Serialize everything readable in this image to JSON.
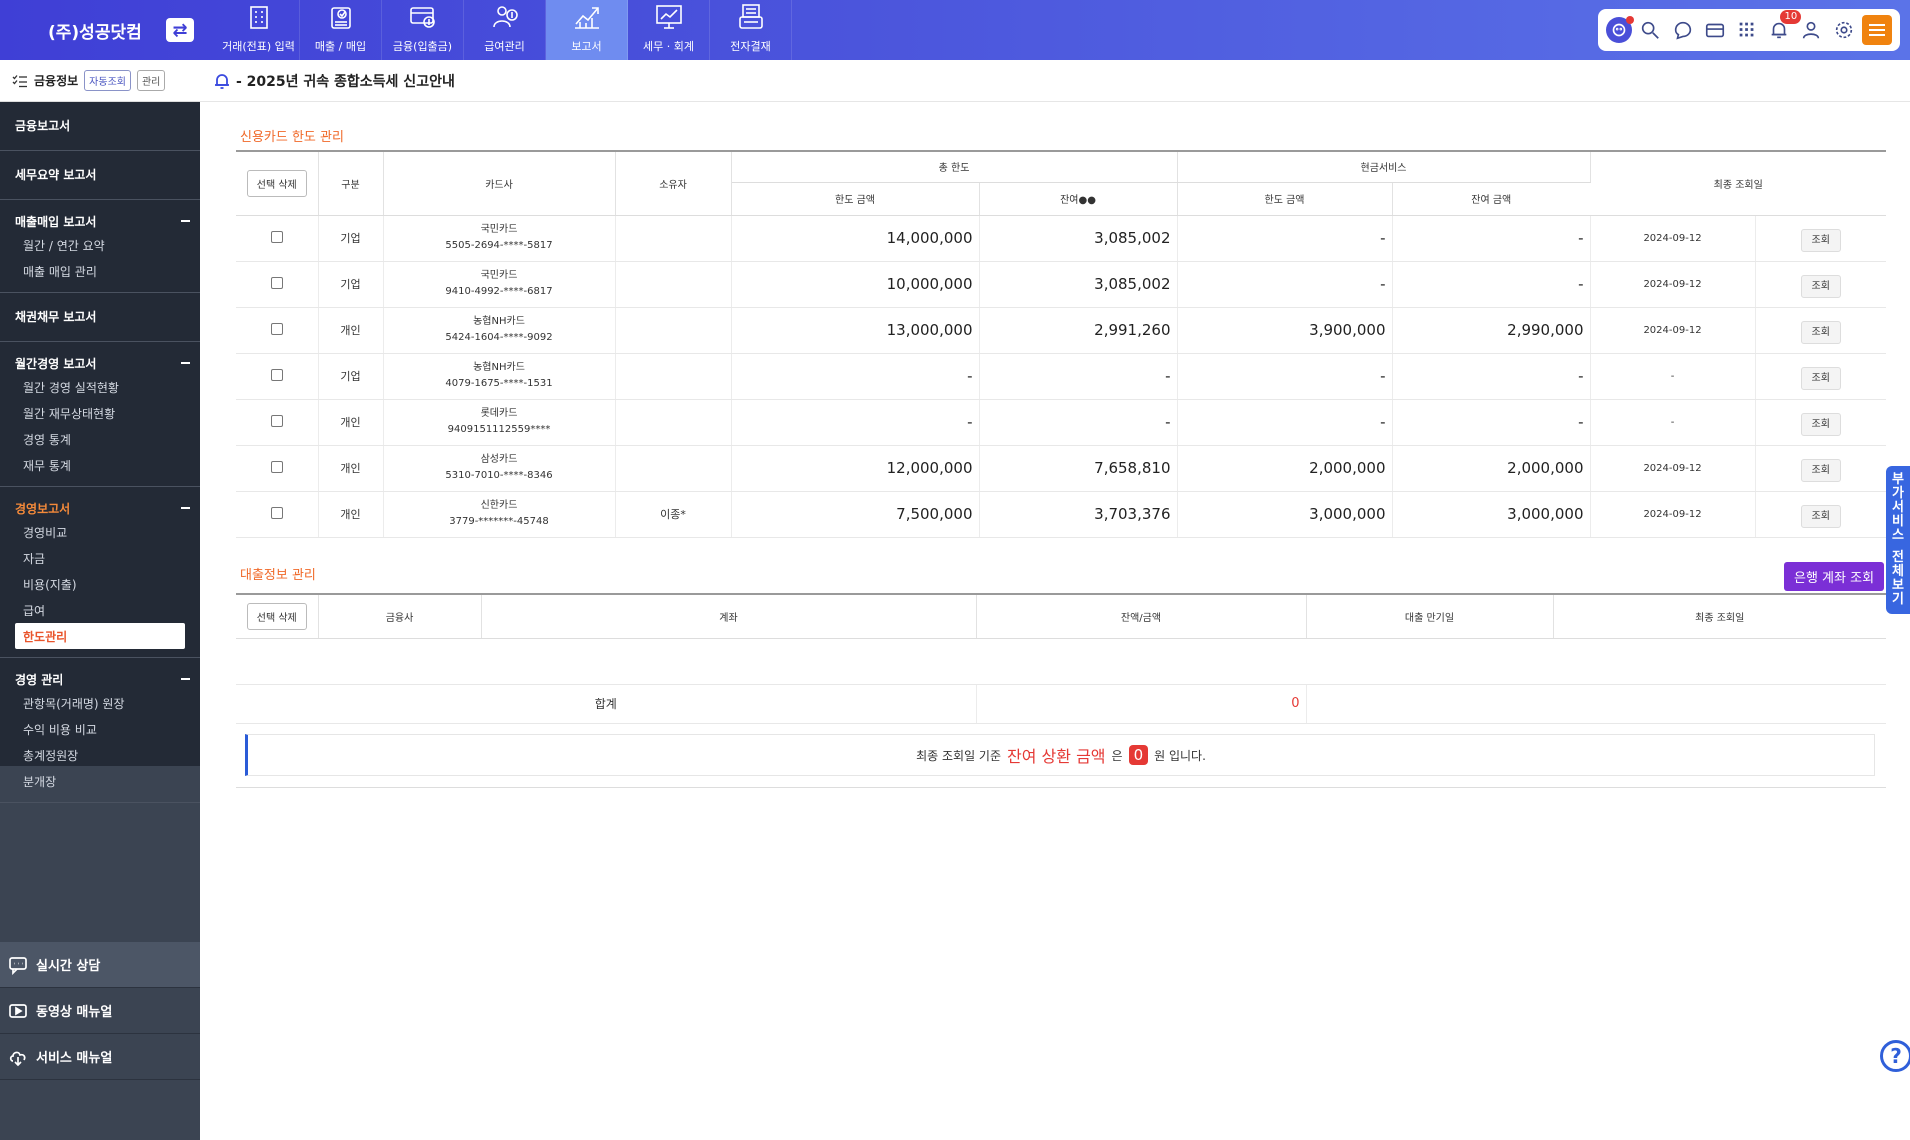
{
  "company": "(주)성공닷컴",
  "nav": [
    {
      "label": "거래(전표) 입력",
      "icon": "building-icon"
    },
    {
      "label": "매출 / 매입",
      "icon": "document-check-icon"
    },
    {
      "label": "금융(입출금)",
      "icon": "card-coin-icon"
    },
    {
      "label": "급여관리",
      "icon": "salary-icon"
    },
    {
      "label": "보고서",
      "icon": "chart-up-icon",
      "active": true
    },
    {
      "label": "세무 · 회계",
      "icon": "presentation-icon"
    },
    {
      "label": "전자결재",
      "icon": "approval-icon"
    }
  ],
  "toolbar": {
    "notification_count": "10"
  },
  "sidebar": {
    "header": {
      "title": "금융정보",
      "tag_auto": "자동조회",
      "tag_manage": "관리"
    },
    "sections": [
      {
        "title": "금융보고서",
        "items": []
      },
      {
        "title": "세무요약 보고서",
        "items": []
      },
      {
        "title": "매출매입 보고서",
        "items": [
          "월간 / 연간 요약",
          "매출 매입 관리"
        ]
      },
      {
        "title": "채권채무 보고서",
        "items": []
      },
      {
        "title": "월간경영 보고서",
        "items": [
          "월간 경영 실적현황",
          "월간 재무상태현황",
          "경영 통계",
          "재무 통계"
        ]
      },
      {
        "title": "경영보고서",
        "items": [
          "경영비교",
          "자금",
          "비용(지출)",
          "급여",
          "한도관리"
        ]
      },
      {
        "title": "경영 관리",
        "items": [
          "관항목(거래명) 원장",
          "수익 비용 비교",
          "총계정원장",
          "분개장"
        ]
      }
    ],
    "bottom": [
      "실시간 상담",
      "동영상 매뉴얼",
      "서비스 매뉴얼"
    ]
  },
  "notice": "- 2025년 귀속 종합소득세 신고안내",
  "credit": {
    "title": "신용카드 한도 관리",
    "delete_label": "선택 삭제",
    "headers": {
      "type": "구분",
      "card": "카드사",
      "owner": "소유자",
      "total_limit": "총 한도",
      "limit_amount": "한도 금액",
      "balance": "잔여●●",
      "cash_service": "현금서비스",
      "cash_limit": "한도 금액",
      "cash_balance": "잔여 금액",
      "last_query": "최종 조회일"
    },
    "view_label": "조회",
    "rows": [
      {
        "type": "기업",
        "card": "국민카드",
        "number": "5505-2694-****-5817",
        "owner": "",
        "limit": "14,000,000",
        "balance": "3,085,002",
        "cash_limit": "-",
        "cash_balance": "-",
        "date": "2024-09-12"
      },
      {
        "type": "기업",
        "card": "국민카드",
        "number": "9410-4992-****-6817",
        "owner": "",
        "limit": "10,000,000",
        "balance": "3,085,002",
        "cash_limit": "-",
        "cash_balance": "-",
        "date": "2024-09-12"
      },
      {
        "type": "개인",
        "card": "농협NH카드",
        "number": "5424-1604-****-9092",
        "owner": "",
        "limit": "13,000,000",
        "balance": "2,991,260",
        "cash_limit": "3,900,000",
        "cash_balance": "2,990,000",
        "date": "2024-09-12"
      },
      {
        "type": "기업",
        "card": "농협NH카드",
        "number": "4079-1675-****-1531",
        "owner": "",
        "limit": "-",
        "balance": "-",
        "cash_limit": "-",
        "cash_balance": "-",
        "date": "-"
      },
      {
        "type": "개인",
        "card": "롯데카드",
        "number": "9409151112559****",
        "owner": "",
        "limit": "-",
        "balance": "-",
        "cash_limit": "-",
        "cash_balance": "-",
        "date": "-"
      },
      {
        "type": "개인",
        "card": "삼성카드",
        "number": "5310-7010-****-8346",
        "owner": "",
        "limit": "12,000,000",
        "balance": "7,658,810",
        "cash_limit": "2,000,000",
        "cash_balance": "2,000,000",
        "date": "2024-09-12"
      },
      {
        "type": "개인",
        "card": "신한카드",
        "number": "3779-*******-45748",
        "owner": "이종*",
        "limit": "7,500,000",
        "balance": "3,703,376",
        "cash_limit": "3,000,000",
        "cash_balance": "3,000,000",
        "date": "2024-09-12"
      }
    ]
  },
  "loan": {
    "title": "대출정보 관리",
    "bank_button": "은행 계좌 조회",
    "delete_label": "선택 삭제",
    "headers": {
      "company": "금융사",
      "account": "계좌",
      "balance": "잔액/금액",
      "maturity": "대출 만기일",
      "last_query": "최종 조회일"
    },
    "total_label": "합계",
    "total_value": "0"
  },
  "summary": {
    "prefix": "최종 조회일 기준",
    "highlight": "잔여 상환 금액",
    "particle": "은",
    "amount": "0",
    "suffix": "원 입니다."
  },
  "side_tab": [
    "부",
    "가",
    "서",
    "비",
    "스",
    "",
    "전",
    "체",
    "보",
    "기"
  ],
  "help": "?"
}
